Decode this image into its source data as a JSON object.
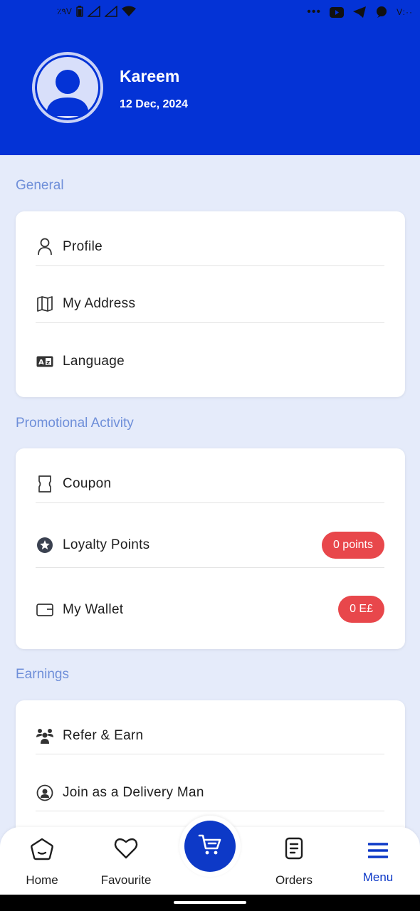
{
  "status_bar": {
    "time": "V:··",
    "left_text": "٪٩V"
  },
  "user": {
    "name": "Kareem",
    "date": "12 Dec, 2024"
  },
  "sections": {
    "general": {
      "title": "General",
      "items": [
        {
          "label": "Profile",
          "icon": "person-icon"
        },
        {
          "label": "My Address",
          "icon": "map-icon"
        },
        {
          "label": "Language",
          "icon": "language-icon"
        }
      ]
    },
    "promotional": {
      "title": "Promotional Activity",
      "items": [
        {
          "label": "Coupon",
          "icon": "coupon-icon"
        },
        {
          "label": "Loyalty Points",
          "icon": "star-icon",
          "badge": "0 points"
        },
        {
          "label": "My Wallet",
          "icon": "wallet-icon",
          "badge": "0 E£"
        }
      ]
    },
    "earnings": {
      "title": "Earnings",
      "items": [
        {
          "label": "Refer & Earn",
          "icon": "people-icon"
        },
        {
          "label": "Join as a Delivery Man",
          "icon": "delivery-man-icon"
        }
      ]
    }
  },
  "bottom_nav": {
    "items": [
      {
        "label": "Home",
        "icon": "home-icon"
      },
      {
        "label": "Favourite",
        "icon": "heart-icon"
      },
      {
        "label": "Orders",
        "icon": "orders-icon"
      },
      {
        "label": "Menu",
        "icon": "menu-icon",
        "active": true
      }
    ],
    "cart_icon": "cart-icon"
  },
  "colors": {
    "primary": "#0433d6",
    "accent": "#0d39c7",
    "badge": "#e8474b",
    "background": "#e5ebfa",
    "section_title": "#6f8fd9"
  }
}
